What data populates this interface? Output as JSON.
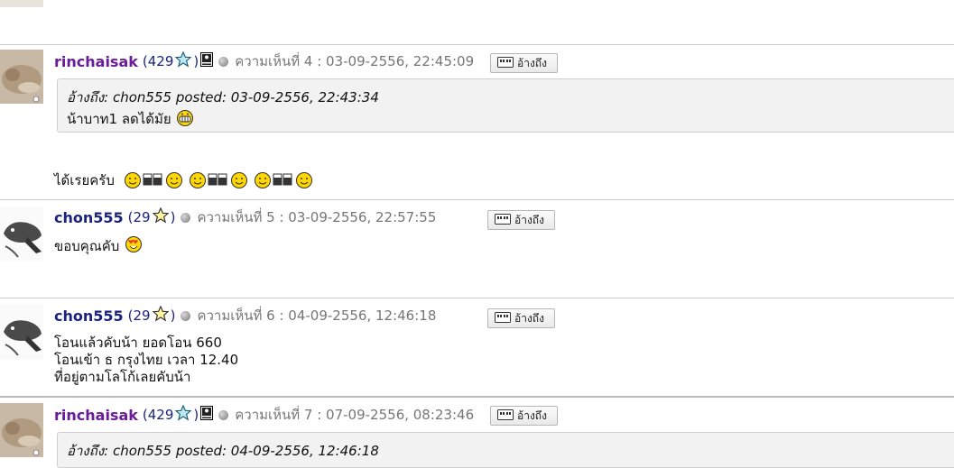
{
  "quote_button_label": "อ้างถึง",
  "posts": [
    {
      "username": "rinchaisak",
      "count": "(429",
      "count_close": ")",
      "meta": "ความเห็นที่ 4 : 03-09-2556, 22:45:09",
      "quote_head": "อ้างถึง: chon555 posted: 03-09-2556, 22:43:34",
      "quote_text": "น้าบาท1 ลดได้มัย",
      "body": "ได้เรยครับ"
    },
    {
      "username": "chon555",
      "count": "(29",
      "count_close": ")",
      "meta": "ความเห็นที่ 5 : 03-09-2556, 22:57:55",
      "body": "ขอบคุณคับ"
    },
    {
      "username": "chon555",
      "count": "(29",
      "count_close": ")",
      "meta": "ความเห็นที่ 6 : 04-09-2556, 12:46:18",
      "lines": [
        "โอนแล้วคับน้า ยอดโอน 660",
        "โอนเข้า ธ กรุงไทย เวลา 12.40",
        "ที่อยู่ตามโลโก้เลยคับน้า"
      ]
    },
    {
      "username": "rinchaisak",
      "count": "(429",
      "count_close": ")",
      "meta": "ความเห็นที่ 7 : 07-09-2556, 08:23:46",
      "quote_head": "อ้างถึง: chon555 posted: 04-09-2556, 12:46:18"
    }
  ],
  "colors": {
    "username_purple": "#6a1b9a",
    "username_navy": "#1a237e",
    "separator": "#c9c9c9",
    "quote_bg": "#f2f2f2"
  }
}
